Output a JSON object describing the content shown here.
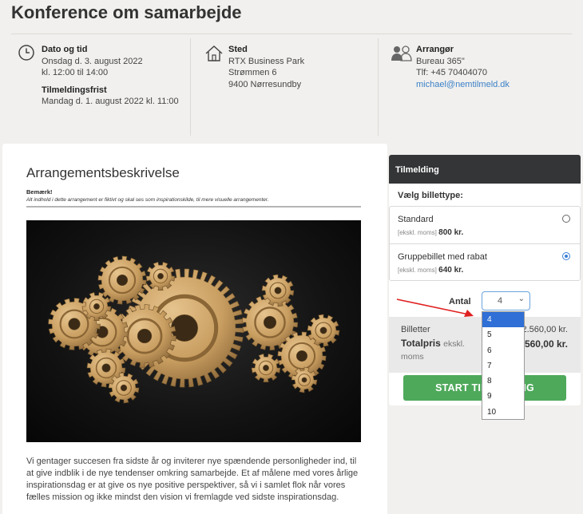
{
  "page": {
    "title": "Konference om samarbejde"
  },
  "event": {
    "date": {
      "icon": "clock-icon",
      "label": "Dato og tid",
      "date": "Onsdag d. 3. august 2022",
      "time": "kl. 12:00 til 14:00",
      "deadline_label": "Tilmeldingsfrist",
      "deadline": "Mandag d. 1. august 2022 kl. 11:00"
    },
    "location": {
      "icon": "house-icon",
      "label": "Sted",
      "name": "RTX Business Park",
      "street": "Strømmen 6",
      "city": "9400 Nørresundby"
    },
    "organizer": {
      "icon": "people-icon",
      "label": "Arrangør",
      "name": "Bureau 365\"",
      "phone": "Tlf: +45 70404070",
      "email": "michael@nemtilmeld.dk"
    }
  },
  "description": {
    "heading": "Arrangementsbeskrivelse",
    "note_title": "Bemærk!",
    "note_text": "Alt indhold i dette arrangement er fiktivt og skal ses som inspirationskilde, til mere visuelle arrangementer.",
    "image_icon": "gears-image",
    "body": "Vi gentager succesen fra sidste år og inviterer nye spændende personligheder ind, til at give indblik i de nye tendenser omkring samarbejde. Et af målene med vores årlige inspirationsdag er at give os nye positive perspektiver, så vi i samlet flok når vores fælles mission og ikke mindst den vision vi fremlagde ved sidste inspirationsdag."
  },
  "registration": {
    "header": "Tilmelding",
    "ticket_type_label": "Vælg billettype:",
    "tickets": [
      {
        "name": "Standard",
        "price_note": "[ekskl. moms]",
        "price": "800 kr.",
        "selected": false
      },
      {
        "name": "Gruppebillet med rabat",
        "price_note": "[ekskl. moms]",
        "price": "640 kr.",
        "selected": true
      }
    ],
    "quantity_label": "Antal",
    "quantity_value": "4",
    "summary": {
      "tickets_label": "Billetter",
      "tickets_value": "2.560,00 kr.",
      "total_label": "Totalpris",
      "total_note": "ekskl. moms",
      "total_value": "2.560,00 kr."
    },
    "start_button": "START TILMELDING",
    "dropdown_options": [
      "4",
      "5",
      "6",
      "7",
      "8",
      "9",
      "10"
    ],
    "dropdown_selected": "4"
  },
  "colors": {
    "accent": "#3b80c6",
    "button_green": "#4ea95b",
    "header_dark": "#333537",
    "annotation_arrow": "#e02020"
  }
}
